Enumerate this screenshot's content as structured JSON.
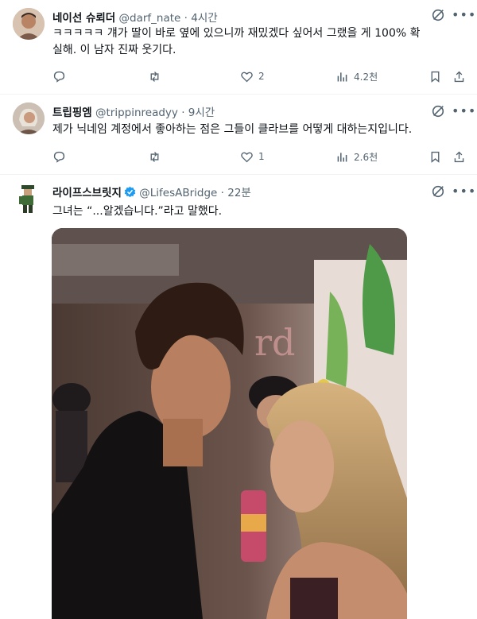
{
  "tweets": [
    {
      "display_name": "네이선 슈뢰더",
      "handle": "@darf_nate",
      "time": "4시간",
      "text_line1": "ㅋㅋㅋㅋㅋ 걔가 딸이 바로 옆에 있으니까 재밌겠다 싶어서 그랬을 게 100% 확",
      "text_line2": "실해. 이 남자 진짜 웃기다.",
      "reply_count": "",
      "retweet_count": "",
      "like_count": "2",
      "view_count": "4.2천"
    },
    {
      "display_name": "트립핑엠",
      "handle": "@trippinreadyy",
      "time": "9시간",
      "text_line1": "제가 닉네임 계정에서 좋아하는 점은 그들이 클라브를 어떻게 대하는지입니다.",
      "reply_count": "",
      "retweet_count": "",
      "like_count": "1",
      "view_count": "2.6천"
    },
    {
      "display_name": "라이프스브릿지",
      "handle": "@LifesABridge",
      "time": "22분",
      "text_line1": "그녀는 “...알겠습니다.”라고 말했다.",
      "verified": true
    }
  ],
  "separator": "·",
  "icons": [
    "reply-icon",
    "retweet-icon",
    "like-icon",
    "views-icon",
    "bookmark-icon",
    "share-icon",
    "grok-icon",
    "more-icon",
    "verified-badge-icon"
  ],
  "colors": {
    "text": "#0f1419",
    "secondary": "#536471",
    "verified": "#1d9bf0",
    "divider": "#eff3f4"
  }
}
